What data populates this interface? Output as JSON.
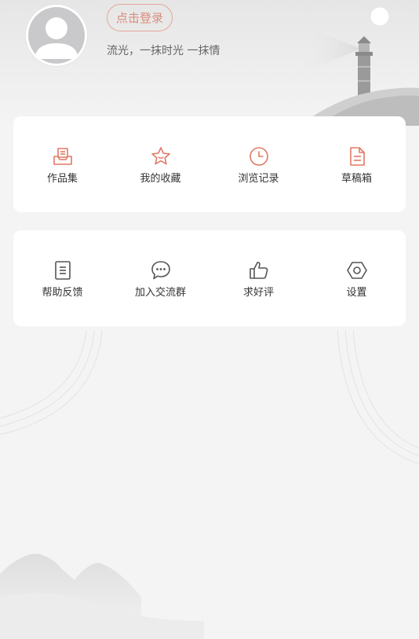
{
  "header": {
    "login_label": "点击登录",
    "subtitle": "流光，一抹时光 一抹情"
  },
  "colors": {
    "accent": "#e07a65",
    "icon_gray": "#555555",
    "background": "#f4f4f4"
  },
  "card1": {
    "items": [
      {
        "label": "作品集",
        "icon": "inbox-icon"
      },
      {
        "label": "我的收藏",
        "icon": "star-icon"
      },
      {
        "label": "浏览记录",
        "icon": "clock-icon"
      },
      {
        "label": "草稿箱",
        "icon": "document-icon"
      }
    ]
  },
  "card2": {
    "items": [
      {
        "label": "帮助反馈",
        "icon": "note-icon"
      },
      {
        "label": "加入交流群",
        "icon": "chat-icon"
      },
      {
        "label": "求好评",
        "icon": "thumbs-up-icon"
      },
      {
        "label": "设置",
        "icon": "settings-hexagon-icon"
      }
    ]
  }
}
